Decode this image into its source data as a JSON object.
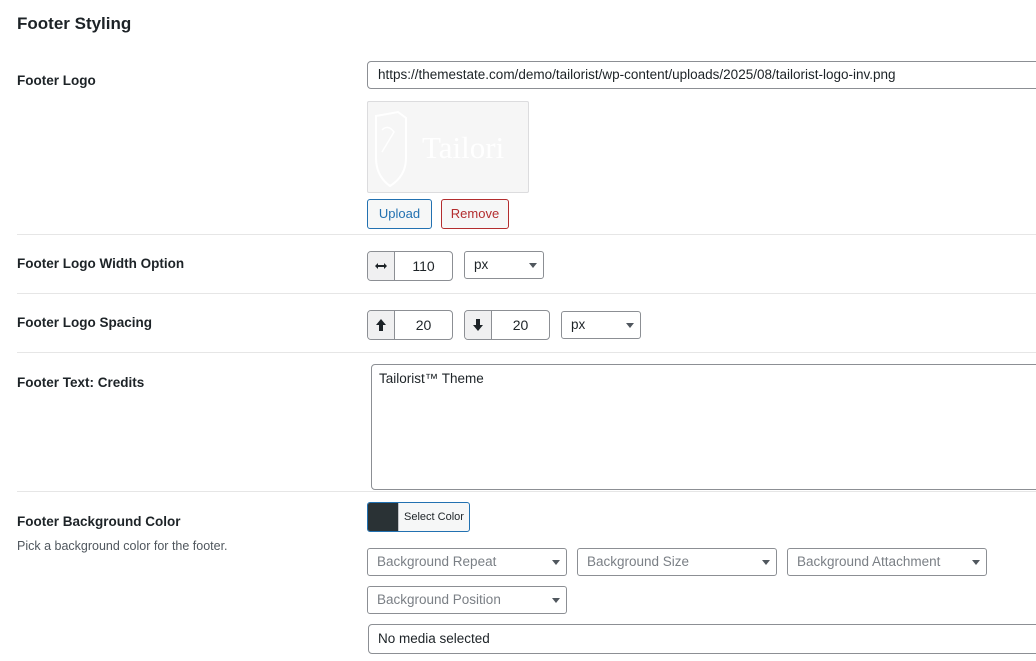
{
  "section": {
    "title": "Footer Styling"
  },
  "footer_logo": {
    "label": "Footer Logo",
    "url": "https://themestate.com/demo/tailorist/wp-content/uploads/2025/08/tailorist-logo-inv.png",
    "preview_text": "Tailori",
    "upload_label": "Upload",
    "remove_label": "Remove"
  },
  "logo_width": {
    "label": "Footer Logo Width Option",
    "value": "110",
    "unit": "px",
    "icon": "horizontal-resize-icon"
  },
  "logo_spacing": {
    "label": "Footer Logo Spacing",
    "top_value": "20",
    "bottom_value": "20",
    "unit": "px",
    "top_icon": "arrow-up-icon",
    "bottom_icon": "arrow-down-icon"
  },
  "footer_credits": {
    "label": "Footer Text: Credits",
    "value": "Tailorist™ Theme"
  },
  "background": {
    "label": "Footer Background Color",
    "description": "Pick a background color for the footer.",
    "color_button_label": "Select Color",
    "color_value": "#2a3235",
    "repeat_placeholder": "Background Repeat",
    "size_placeholder": "Background Size",
    "attachment_placeholder": "Background Attachment",
    "position_placeholder": "Background Position",
    "media_text": "No media selected"
  }
}
